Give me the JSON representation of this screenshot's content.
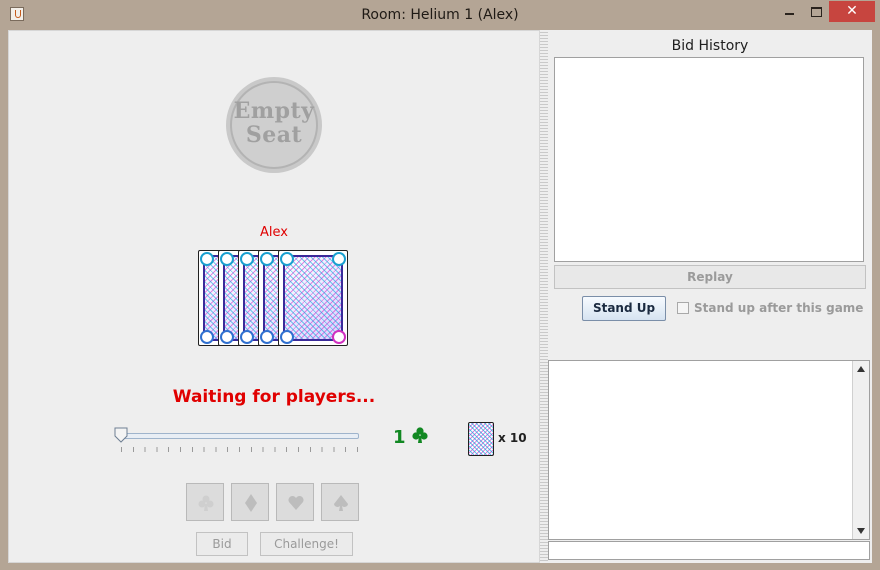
{
  "window": {
    "title": "Room: Helium 1 (Alex)",
    "close_glyph": "✕",
    "controls": [
      "minimize-icon",
      "maximize-icon",
      "close-icon"
    ]
  },
  "table": {
    "empty_seat": {
      "line1": "Empty",
      "line2": "Seat"
    },
    "player_name": "Alex",
    "hand_card_count": 5,
    "status": "Waiting for players...",
    "bid": {
      "quantity": "1",
      "suit_icon": "club-icon",
      "slider_level": 0
    },
    "deck": {
      "count_label": "x 10"
    },
    "suit_buttons": [
      "club-icon",
      "diamond-icon",
      "heart-icon",
      "spade-icon"
    ],
    "buttons": {
      "bid": "Bid",
      "challenge": "Challenge!"
    }
  },
  "sidebar": {
    "bid_history_label": "Bid History",
    "replay_label": "Replay",
    "stand_up_label": "Stand Up",
    "stand_up_after_label": "Stand up after this game",
    "stand_up_after_checked": false
  },
  "colors": {
    "status_red": "#e00000",
    "bid_green": "#118822",
    "window_frame": "#b4a595"
  }
}
